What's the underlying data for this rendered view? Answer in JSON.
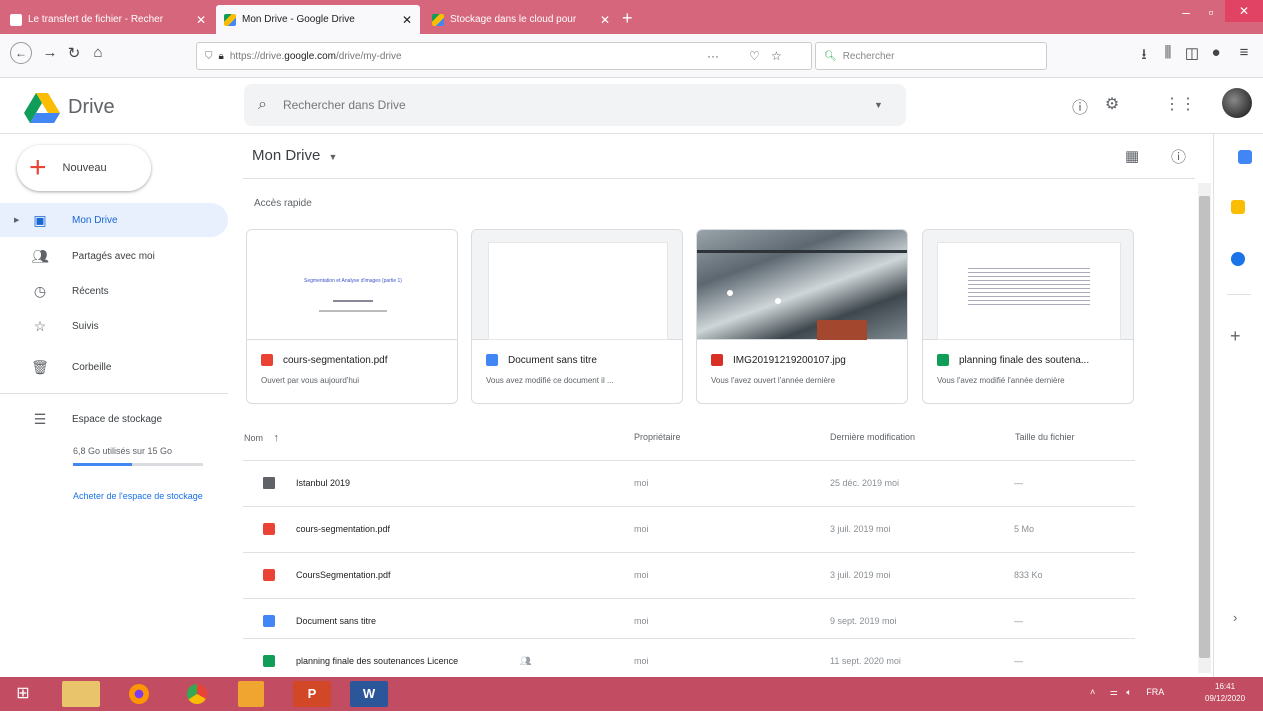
{
  "browser": {
    "tabs": [
      {
        "label": "Le transfert de fichier - Recher",
        "active": false
      },
      {
        "label": "Mon Drive - Google Drive",
        "active": true
      },
      {
        "label": "Stockage dans le cloud pour",
        "active": false
      }
    ],
    "url_prefix": "https://drive.",
    "url_domain": "google.com",
    "url_path": "/drive/my-drive",
    "url_menu": "···",
    "search_placeholder": "Rechercher"
  },
  "header": {
    "app_name": "Drive",
    "search_placeholder": "Rechercher dans Drive"
  },
  "sidebar": {
    "new_label": "Nouveau",
    "items": [
      {
        "label": "Mon Drive",
        "icon": "drive-icon"
      },
      {
        "label": "Partagés avec moi",
        "icon": "shared-icon"
      },
      {
        "label": "Récents",
        "icon": "clock-icon"
      },
      {
        "label": "Suivis",
        "icon": "star-icon"
      },
      {
        "label": "Corbeille",
        "icon": "trash-icon"
      }
    ],
    "storage_label": "Espace de stockage",
    "storage_used": "6,8 Go utilisés sur 15 Go",
    "storage_fraction": 0.45,
    "buy_storage": "Acheter de l'espace de stockage"
  },
  "main": {
    "title": "Mon Drive",
    "quick_access_label": "Accès rapide",
    "quick_cards": [
      {
        "name": "cours-segmentation.pdf",
        "sub": "Ouvert par vous aujourd'hui",
        "type": "pdf",
        "thumb_text": "Segmentation et Analyse d'images (partie 1)"
      },
      {
        "name": "Document sans titre",
        "sub": "Vous avez modifié ce document il ...",
        "type": "doc"
      },
      {
        "name": "IMG20191219200107.jpg",
        "sub": "Vous l'avez ouvert l'année dernière",
        "type": "img"
      },
      {
        "name": "planning finale des soutena...",
        "sub": "Vous l'avez modifié l'année dernière",
        "type": "sheet"
      }
    ],
    "columns": {
      "name": "Nom",
      "owner": "Propriétaire",
      "modified": "Dernière modification",
      "size": "Taille du fichier"
    },
    "files": [
      {
        "name": "Istanbul 2019",
        "type": "folder",
        "owner": "moi",
        "modified": "25 déc. 2019 moi",
        "size": "—"
      },
      {
        "name": "cours-segmentation.pdf",
        "type": "pdf",
        "owner": "moi",
        "modified": "3 juil. 2019 moi",
        "size": "5 Mo"
      },
      {
        "name": "CoursSegmentation.pdf",
        "type": "pdf",
        "owner": "moi",
        "modified": "3 juil. 2019 moi",
        "size": "833 Ko"
      },
      {
        "name": "Document sans titre",
        "type": "doc",
        "owner": "moi",
        "modified": "9 sept. 2019 moi",
        "size": "—"
      },
      {
        "name": "planning finale des soutenances Licence",
        "type": "sheet",
        "owner": "moi",
        "modified": "11 sept. 2020 moi",
        "size": "—"
      }
    ]
  },
  "taskbar": {
    "lang": "FRA",
    "time": "16:41",
    "date": "09/12/2020"
  },
  "colors": {
    "accent": "#1967d2",
    "tabbar": "#d6667c",
    "taskbar": "#c24d62"
  }
}
